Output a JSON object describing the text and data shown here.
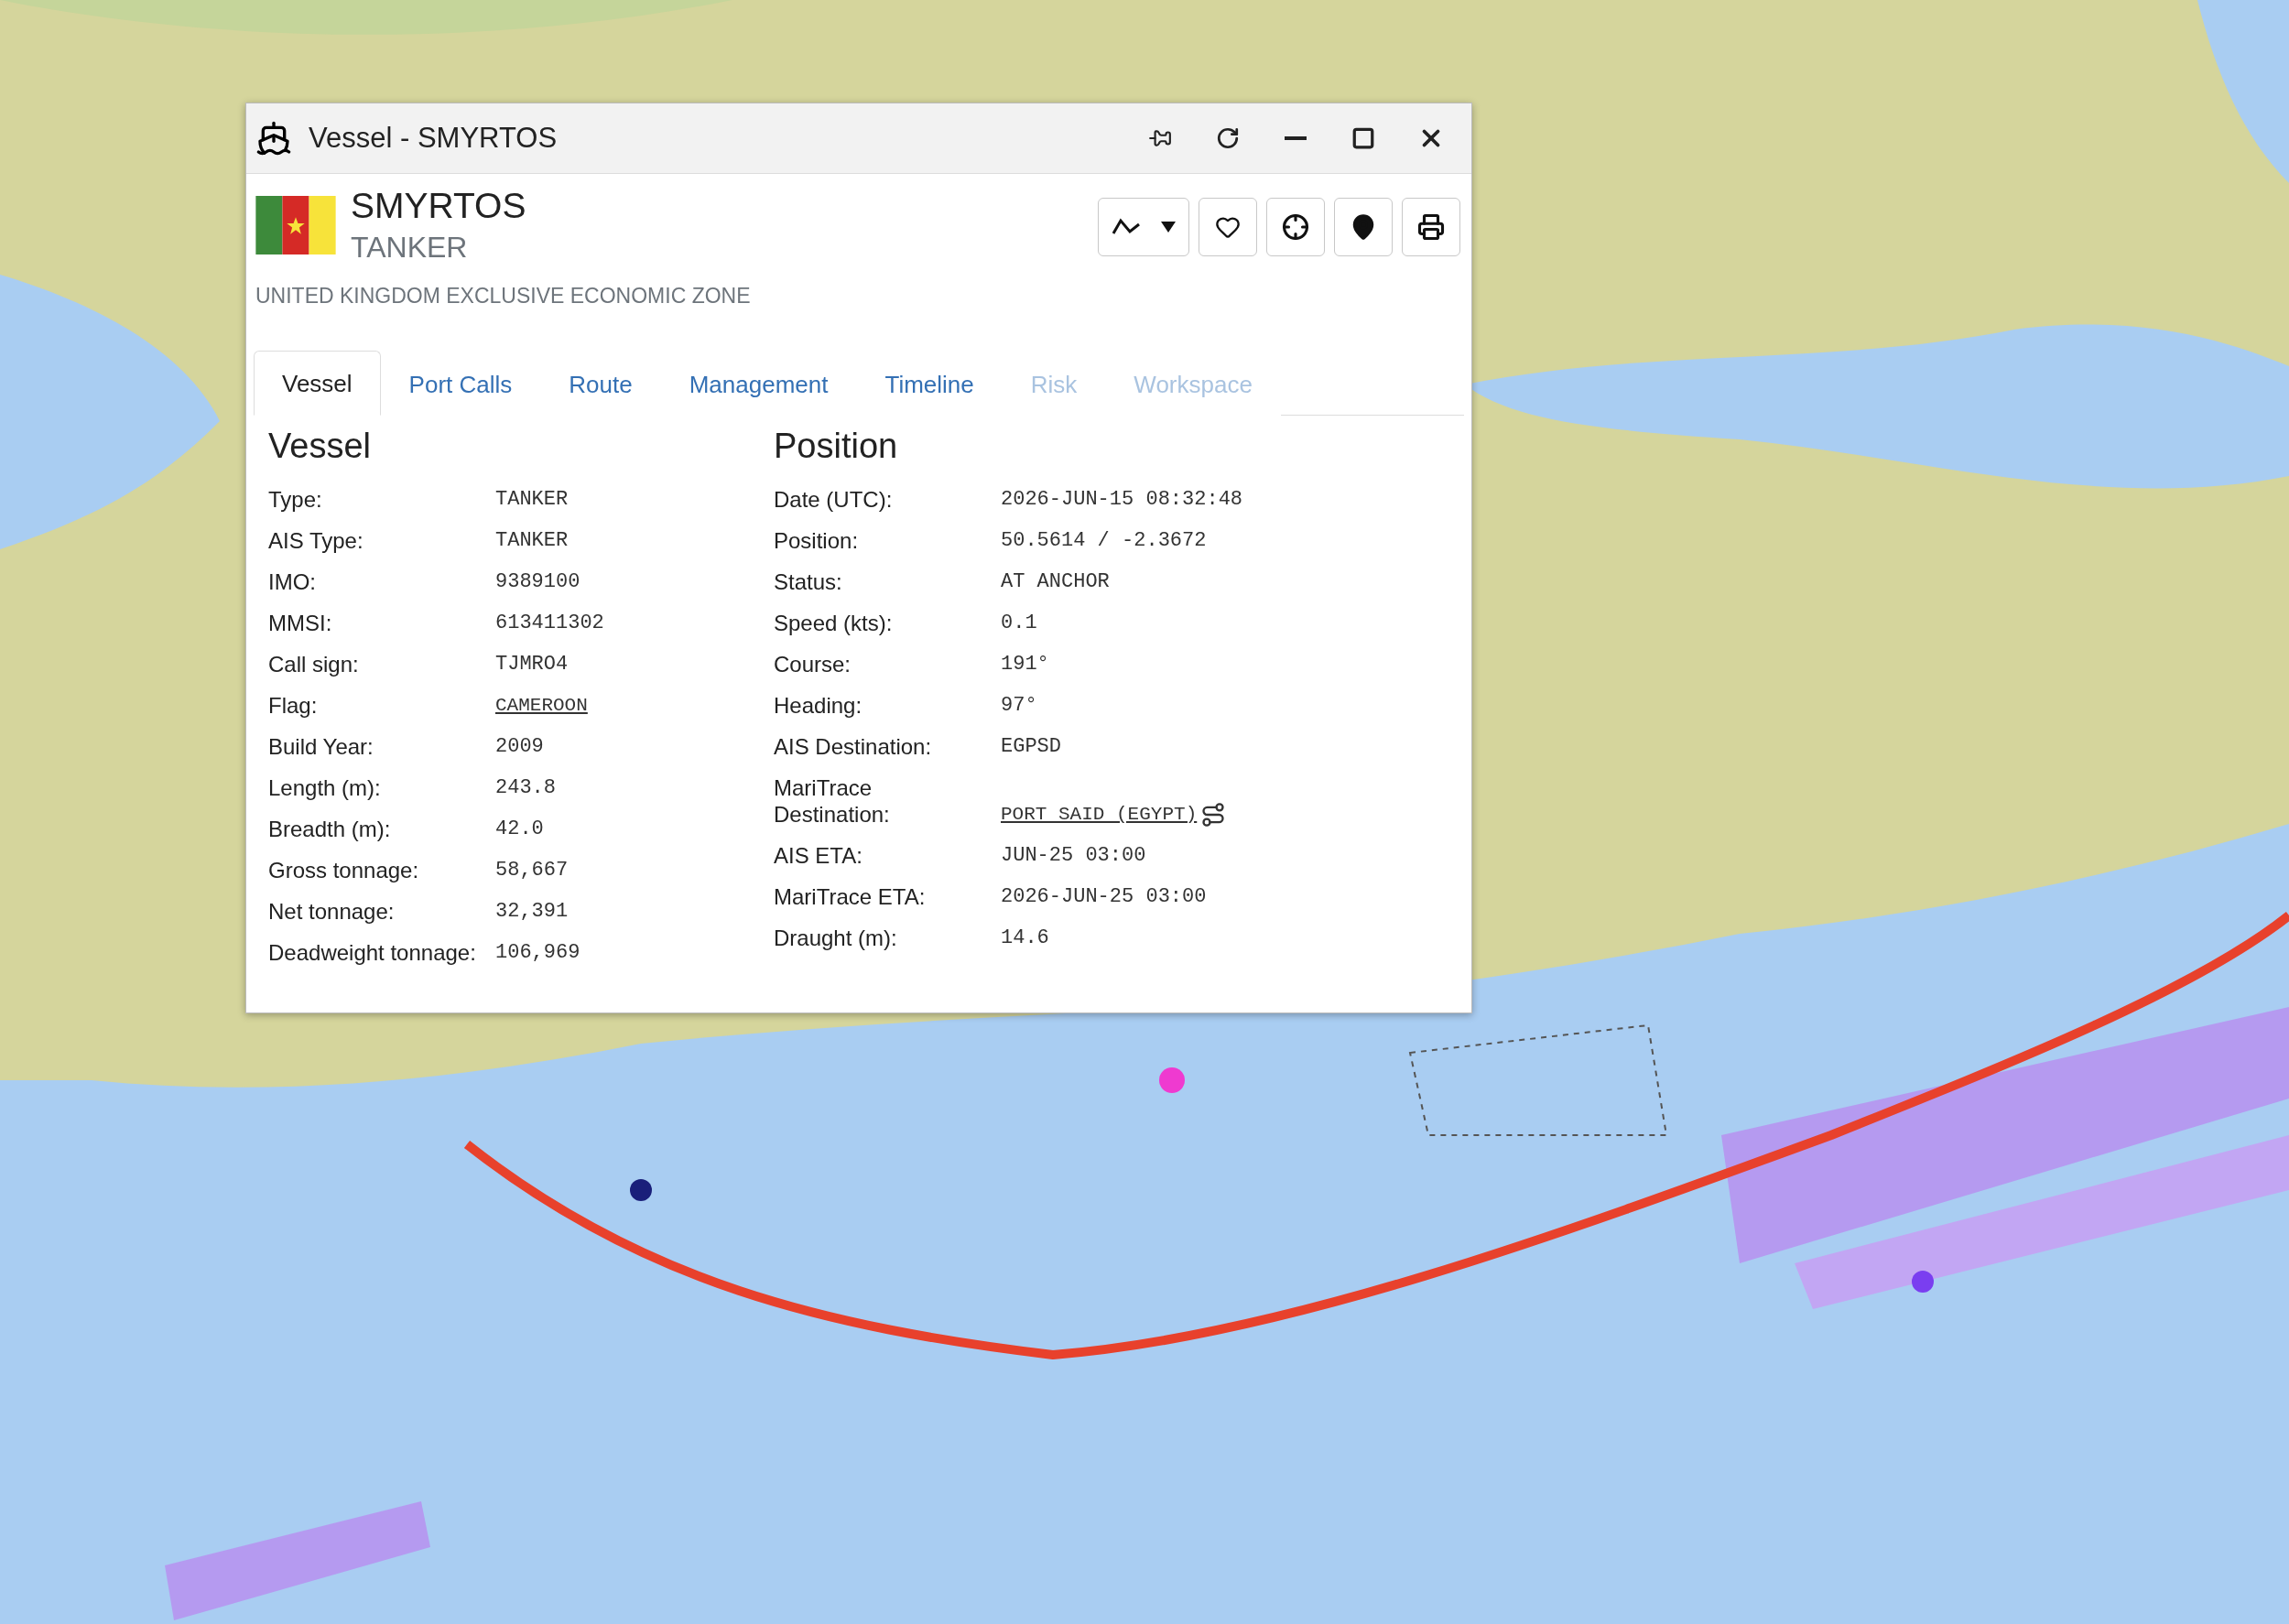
{
  "window": {
    "title": "Vessel - SMYRTOS"
  },
  "vessel": {
    "name": "SMYRTOS",
    "type": "TANKER",
    "zone": "UNITED KINGDOM EXCLUSIVE ECONOMIC ZONE"
  },
  "tabs": [
    {
      "label": "Vessel",
      "selected": true,
      "disabled": false
    },
    {
      "label": "Port Calls",
      "selected": false,
      "disabled": false
    },
    {
      "label": "Route",
      "selected": false,
      "disabled": false
    },
    {
      "label": "Management",
      "selected": false,
      "disabled": false
    },
    {
      "label": "Timeline",
      "selected": false,
      "disabled": false
    },
    {
      "label": "Risk",
      "selected": false,
      "disabled": true
    },
    {
      "label": "Workspace",
      "selected": false,
      "disabled": true
    }
  ],
  "sections": [
    {
      "title": "Vessel",
      "rows": [
        {
          "label": "Type:",
          "value": "TANKER",
          "kind": "plain"
        },
        {
          "label": "AIS Type:",
          "value": "TANKER",
          "kind": "plain"
        },
        {
          "label": "IMO:",
          "value": "9389100",
          "kind": "plain"
        },
        {
          "label": "MMSI:",
          "value": "613411302",
          "kind": "plain"
        },
        {
          "label": "Call sign:",
          "value": "TJMRO4",
          "kind": "plain"
        },
        {
          "label": "Flag:",
          "value": "CAMEROON",
          "kind": "link"
        },
        {
          "label": "Build Year:",
          "value": "2009",
          "kind": "plain"
        },
        {
          "label": "Length (m):",
          "value": "243.8",
          "kind": "plain"
        },
        {
          "label": "Breadth (m):",
          "value": "42.0",
          "kind": "plain"
        },
        {
          "label": "Gross tonnage:",
          "value": "58,667",
          "kind": "plain"
        },
        {
          "label": "Net tonnage:",
          "value": "32,391",
          "kind": "plain"
        },
        {
          "label": "Deadweight tonnage:",
          "value": "106,969",
          "kind": "plain"
        }
      ]
    },
    {
      "title": "Position",
      "rows": [
        {
          "label": "Date (UTC):",
          "value": "2026-JUN-15 08:32:48",
          "kind": "plain"
        },
        {
          "label": "Position:",
          "value": "50.5614 / -2.3672",
          "kind": "plain"
        },
        {
          "label": "Status:",
          "value": "AT ANCHOR",
          "kind": "plain"
        },
        {
          "label": "Speed (kts):",
          "value": "0.1",
          "kind": "plain"
        },
        {
          "label": "Course:",
          "value": "191°",
          "kind": "plain"
        },
        {
          "label": "Heading:",
          "value": "97°",
          "kind": "plain"
        },
        {
          "label": "AIS Destination:",
          "value": "EGPSD",
          "kind": "plain"
        },
        {
          "label": "MariTrace Destination:",
          "value": "PORT SAID (EGYPT)",
          "kind": "destination"
        },
        {
          "label": "AIS ETA:",
          "value": "JUN-25 03:00",
          "kind": "plain"
        },
        {
          "label": "MariTrace ETA:",
          "value": "2026-JUN-25 03:00",
          "kind": "plain"
        },
        {
          "label": "Draught (m):",
          "value": "14.6",
          "kind": "plain"
        }
      ]
    }
  ]
}
